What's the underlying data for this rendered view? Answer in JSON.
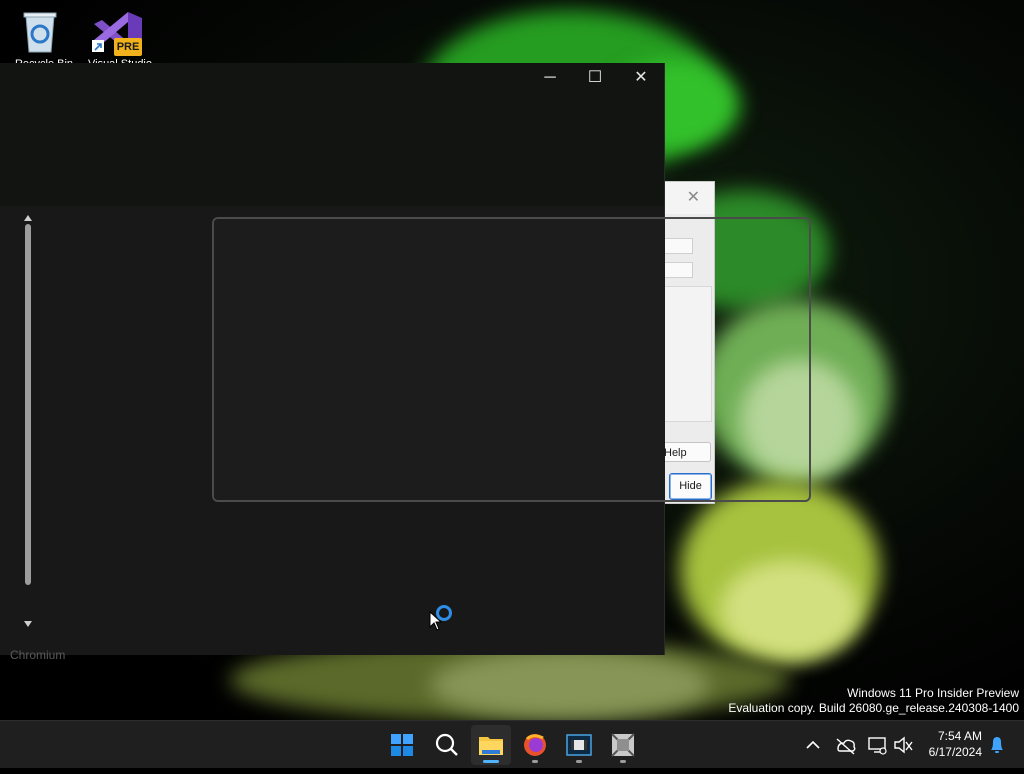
{
  "desktop": {
    "icons": [
      {
        "label": "Recycle Bin"
      },
      {
        "label": "Visual Studio",
        "badge": "PRE"
      }
    ],
    "background_label": "Chromium"
  },
  "main_window": {
    "caption_buttons": {
      "minimize": "─",
      "maximize": "☐",
      "close": "✕"
    }
  },
  "dialog": {
    "close_glyph": "✕",
    "buttons": {
      "help": "Help",
      "hide": "Hide"
    }
  },
  "watermark": {
    "line1": "Windows 11 Pro Insider Preview",
    "line2": "Evaluation copy. Build 26080.ge_release.240308-1400"
  },
  "taskbar": {
    "apps": [
      {
        "name": "start-icon"
      },
      {
        "name": "search-icon"
      },
      {
        "name": "file-explorer-icon",
        "active": true
      },
      {
        "name": "firefox-icon"
      },
      {
        "name": "video-editor-icon"
      },
      {
        "name": "generic-app-icon"
      }
    ],
    "tray": {
      "chevron": "^"
    },
    "clock": {
      "time": "7:54 AM",
      "date": "6/17/2024"
    }
  },
  "colors": {
    "accent": "#2e8ee6",
    "dialog_hide_border": "#2a6ec9",
    "badge": "#f2b21c"
  }
}
